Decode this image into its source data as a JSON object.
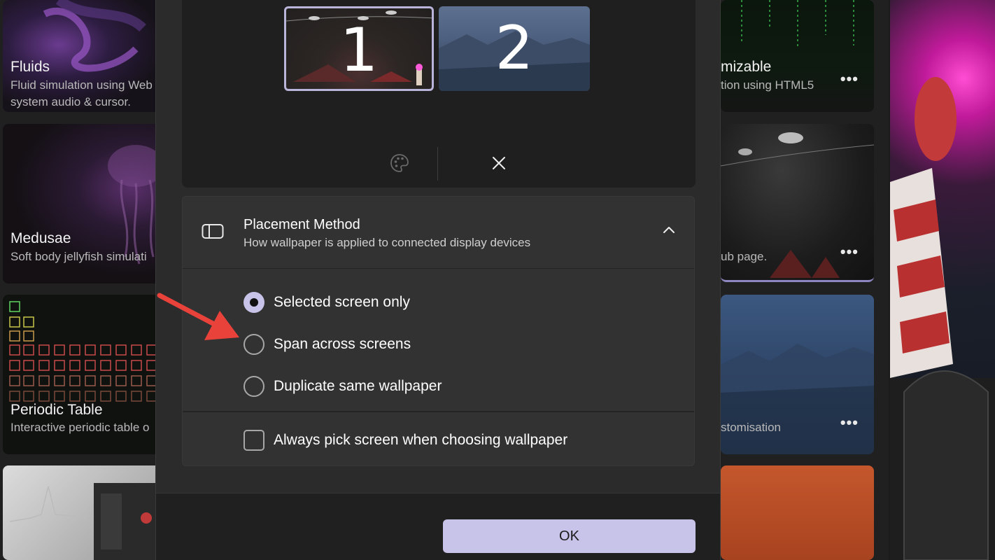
{
  "background_cards": {
    "fluids": {
      "title": "Fluids",
      "desc1": "Fluid simulation using Web",
      "desc2": "system audio & cursor."
    },
    "medusae": {
      "title": "Medusae",
      "desc": "Soft body jellyfish simulati"
    },
    "periodic": {
      "title": "Periodic Table",
      "desc": "Interactive periodic table o"
    },
    "customizable": {
      "title": "mizable",
      "desc": "tion using HTML5"
    },
    "dark": {
      "desc": "ub page."
    },
    "mountain": {
      "desc": "stomisation"
    },
    "more_label": "•••"
  },
  "monitors": [
    {
      "number": "1",
      "selected": true
    },
    {
      "number": "2",
      "selected": false
    }
  ],
  "placement": {
    "title": "Placement Method",
    "subtitle": "How wallpaper is applied to connected display devices",
    "options": [
      {
        "label": "Selected screen only",
        "checked": true
      },
      {
        "label": "Span across screens",
        "checked": false
      },
      {
        "label": "Duplicate same wallpaper",
        "checked": false
      }
    ],
    "always_pick_label": "Always pick screen when choosing wallpaper"
  },
  "footer": {
    "ok_label": "OK"
  },
  "colors": {
    "accent": "#c8c3e8",
    "annotation_arrow": "#e8423a"
  }
}
